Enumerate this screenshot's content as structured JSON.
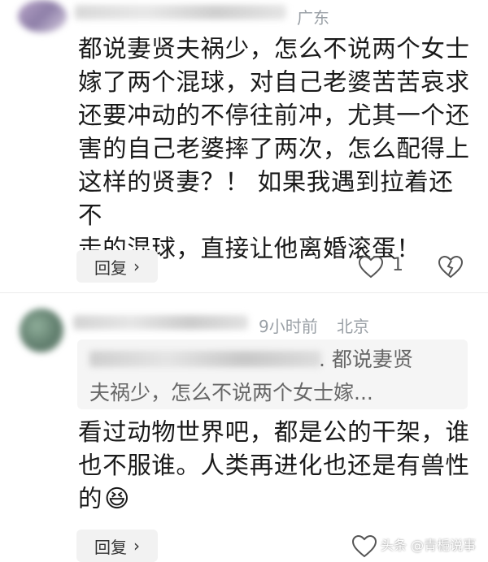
{
  "comment1": {
    "location": "广东",
    "lines": [
      "都说妻贤夫祸少，怎么不说两个女士",
      "嫁了两个混球，对自己老婆苦苦哀求",
      "还要冲动的不停往前冲，尤其一个还",
      "害的自己老婆摔了两次，怎么配得上",
      "这样的贤妻？！ 如果我遇到拉着还不",
      "走的混球，直接让他离婚滚蛋！"
    ],
    "reply_label": "回复",
    "like_count": "1"
  },
  "comment2": {
    "time": "9小时前",
    "location": "北京",
    "quote_line1": ". 都说妻贤",
    "quote_line2": "夫祸少，怎么不说两个女士嫁...",
    "lines": [
      "看过动物世界吧，都是公的干架，谁",
      "也不服谁。人类再进化也还是有兽性",
      "的"
    ],
    "emoji": "😆",
    "reply_label": "回复"
  },
  "watermark": "头条 @青梔说事",
  "colors": {
    "meta_gray": "#9aa0a6",
    "reply_bg": "#f2f2f2",
    "quote_bg": "#f5f5f5"
  }
}
